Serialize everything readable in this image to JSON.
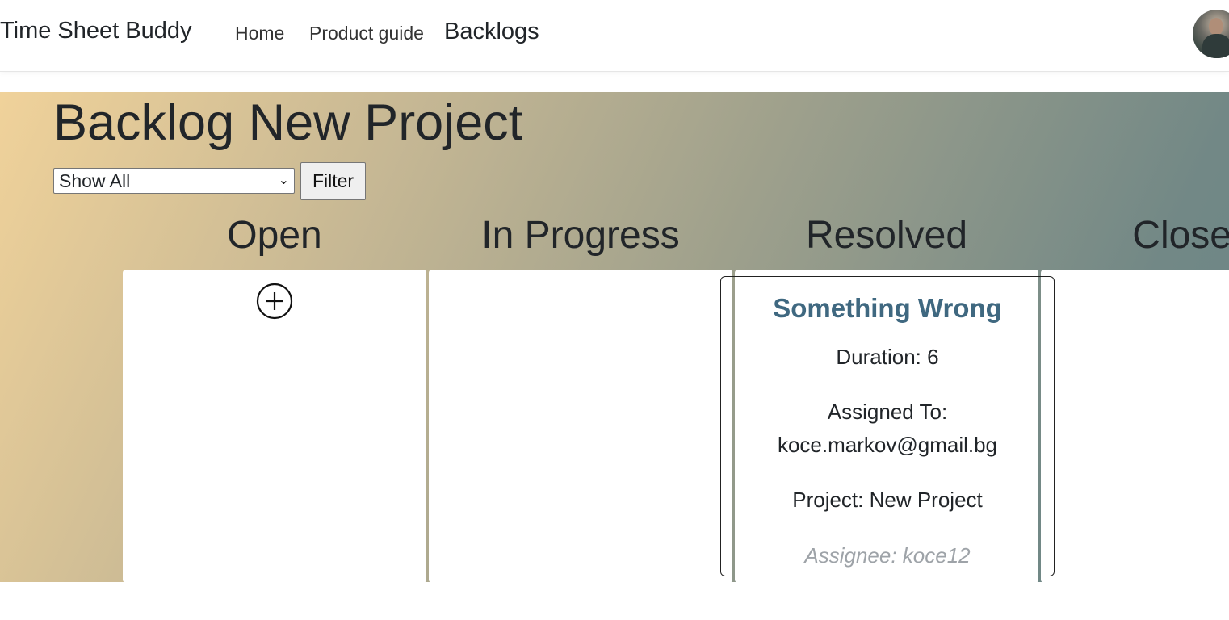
{
  "navbar": {
    "brand": "Time Sheet Buddy",
    "links": [
      {
        "label": "Home"
      },
      {
        "label": "Product guide"
      },
      {
        "label": "Backlogs"
      }
    ],
    "avatar_icon": "user-avatar"
  },
  "backlog": {
    "title": "Backlog New Project",
    "filter": {
      "selected": "Show All",
      "button_label": "Filter"
    },
    "columns": [
      {
        "name": "Open"
      },
      {
        "name": "In Progress"
      },
      {
        "name": "Resolved"
      },
      {
        "name": "Closed"
      }
    ],
    "add_icon": "plus-circle-icon",
    "cards": [
      {
        "title": "Something Wrong",
        "duration": "Duration: 6",
        "assigned_to_label": "Assigned To:",
        "assigned_to_email": "koce.markov@gmail.bg",
        "project": "Project: New Project",
        "assignee": "Assignee: koce12"
      }
    ]
  },
  "colors": {
    "card_title": "#3f6880",
    "gradient_start": "#f0d29a",
    "gradient_end": "#6a8585",
    "muted_text": "#9ea3a8"
  }
}
